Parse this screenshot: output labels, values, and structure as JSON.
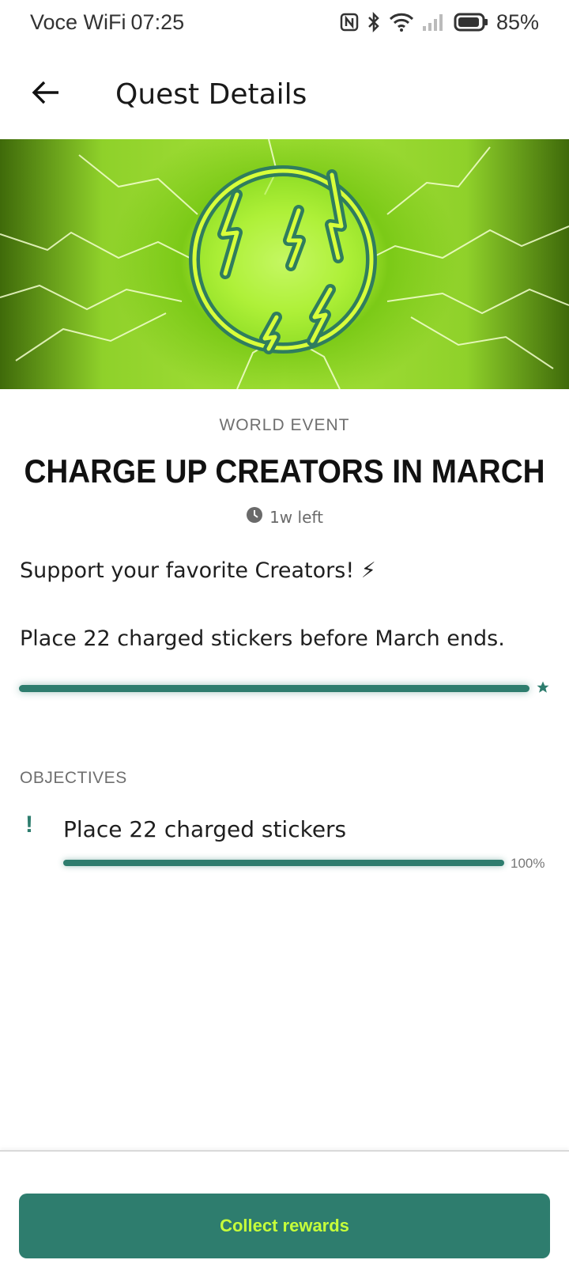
{
  "status_bar": {
    "carrier": "Voce WiFi",
    "time": "07:25",
    "battery": "85%",
    "icons": [
      "nfc-icon",
      "bluetooth-icon",
      "wifi-icon",
      "signal-icon",
      "battery-icon"
    ]
  },
  "app_bar": {
    "back_icon": "arrow-left-icon",
    "title": "Quest Details"
  },
  "quest": {
    "type": "WORLD EVENT",
    "title": "CHARGE UP CREATORS IN MARCH",
    "time_left": "1w left",
    "description_1": "Support your favorite Creators! ⚡",
    "description_2": "Place 22 charged stickers before March ends.",
    "progress_fraction": 1.0
  },
  "objectives": {
    "label": "OBJECTIVES",
    "items": [
      {
        "text": "Place 22 charged stickers",
        "percent_label": "100%",
        "progress": 1.0
      }
    ]
  },
  "actions": {
    "collect_label": "Collect rewards"
  },
  "colors": {
    "accent": "#2e7d6e",
    "button_text": "#c6ff3a"
  }
}
